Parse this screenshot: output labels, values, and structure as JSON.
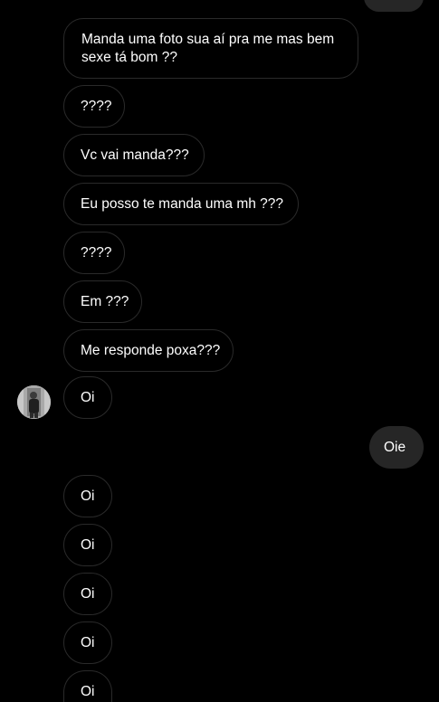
{
  "conversation": {
    "messages": [
      {
        "text": "Manda uma foto sua aí pra me mas bem sexe tá bom ??"
      },
      {
        "text": "????"
      },
      {
        "text": "Vc vai manda???"
      },
      {
        "text": "Eu posso te manda uma mh ???"
      },
      {
        "text": "????"
      },
      {
        "text": "Em ???"
      },
      {
        "text": "Me responde poxa???"
      },
      {
        "text": "Oi"
      },
      {
        "text": "Oie"
      },
      {
        "text": "Oi"
      },
      {
        "text": "Oi"
      },
      {
        "text": "Oi"
      },
      {
        "text": "Oi"
      },
      {
        "text": "Oi"
      }
    ]
  },
  "colors": {
    "background": "#000000",
    "incoming_bubble_border": "#2a2a2a",
    "outgoing_bubble": "#262626",
    "text": "#ffffff"
  },
  "icons": {
    "avatar": "contact-avatar-photo"
  }
}
